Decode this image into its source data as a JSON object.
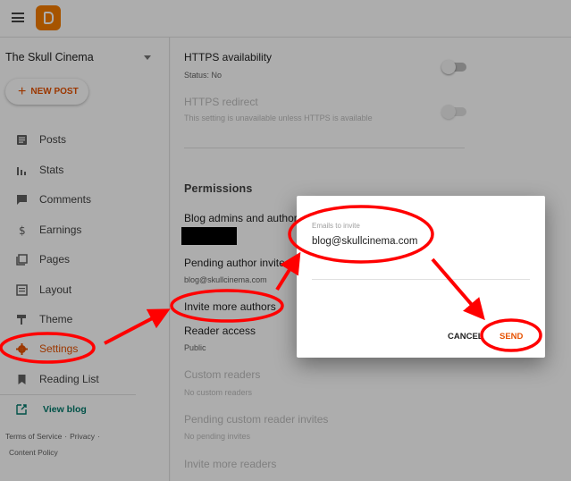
{
  "sidebar": {
    "blog_name": "The Skull Cinema",
    "new_post": "NEW POST",
    "items": [
      {
        "label": "Posts",
        "icon": "posts-icon"
      },
      {
        "label": "Stats",
        "icon": "stats-icon"
      },
      {
        "label": "Comments",
        "icon": "comments-icon"
      },
      {
        "label": "Earnings",
        "icon": "earnings-icon"
      },
      {
        "label": "Pages",
        "icon": "pages-icon"
      },
      {
        "label": "Layout",
        "icon": "layout-icon"
      },
      {
        "label": "Theme",
        "icon": "theme-icon"
      },
      {
        "label": "Settings",
        "icon": "gear-icon",
        "active": true
      },
      {
        "label": "Reading List",
        "icon": "bookmark-icon"
      }
    ],
    "view_blog": "View blog",
    "footer": {
      "terms": "Terms of Service",
      "privacy": "Privacy",
      "content_policy": "Content Policy",
      "separator": "·"
    }
  },
  "main": {
    "https_availability": {
      "title": "HTTPS availability",
      "status": "Status: No"
    },
    "https_redirect": {
      "title": "HTTPS redirect",
      "note": "This setting is unavailable unless HTTPS is available"
    },
    "permissions_title": "Permissions",
    "blog_admins": "Blog admins and authors",
    "pending_invites": {
      "title": "Pending author invites",
      "email": "blog@skullcinema.com"
    },
    "invite_more_authors": "Invite more authors",
    "reader_access": {
      "title": "Reader access",
      "value": "Public"
    },
    "custom_readers": {
      "title": "Custom readers",
      "value": "No custom readers"
    },
    "pending_custom": {
      "title": "Pending custom reader invites",
      "value": "No pending invites"
    },
    "invite_more_readers": "Invite more readers"
  },
  "dialog": {
    "field_label": "Emails to invite",
    "field_value": "blog@skullcinema.com",
    "cancel": "CANCEL",
    "send": "SEND"
  },
  "colors": {
    "accent": "#e65100",
    "annotation": "#ff0000",
    "teal": "#00796b"
  }
}
